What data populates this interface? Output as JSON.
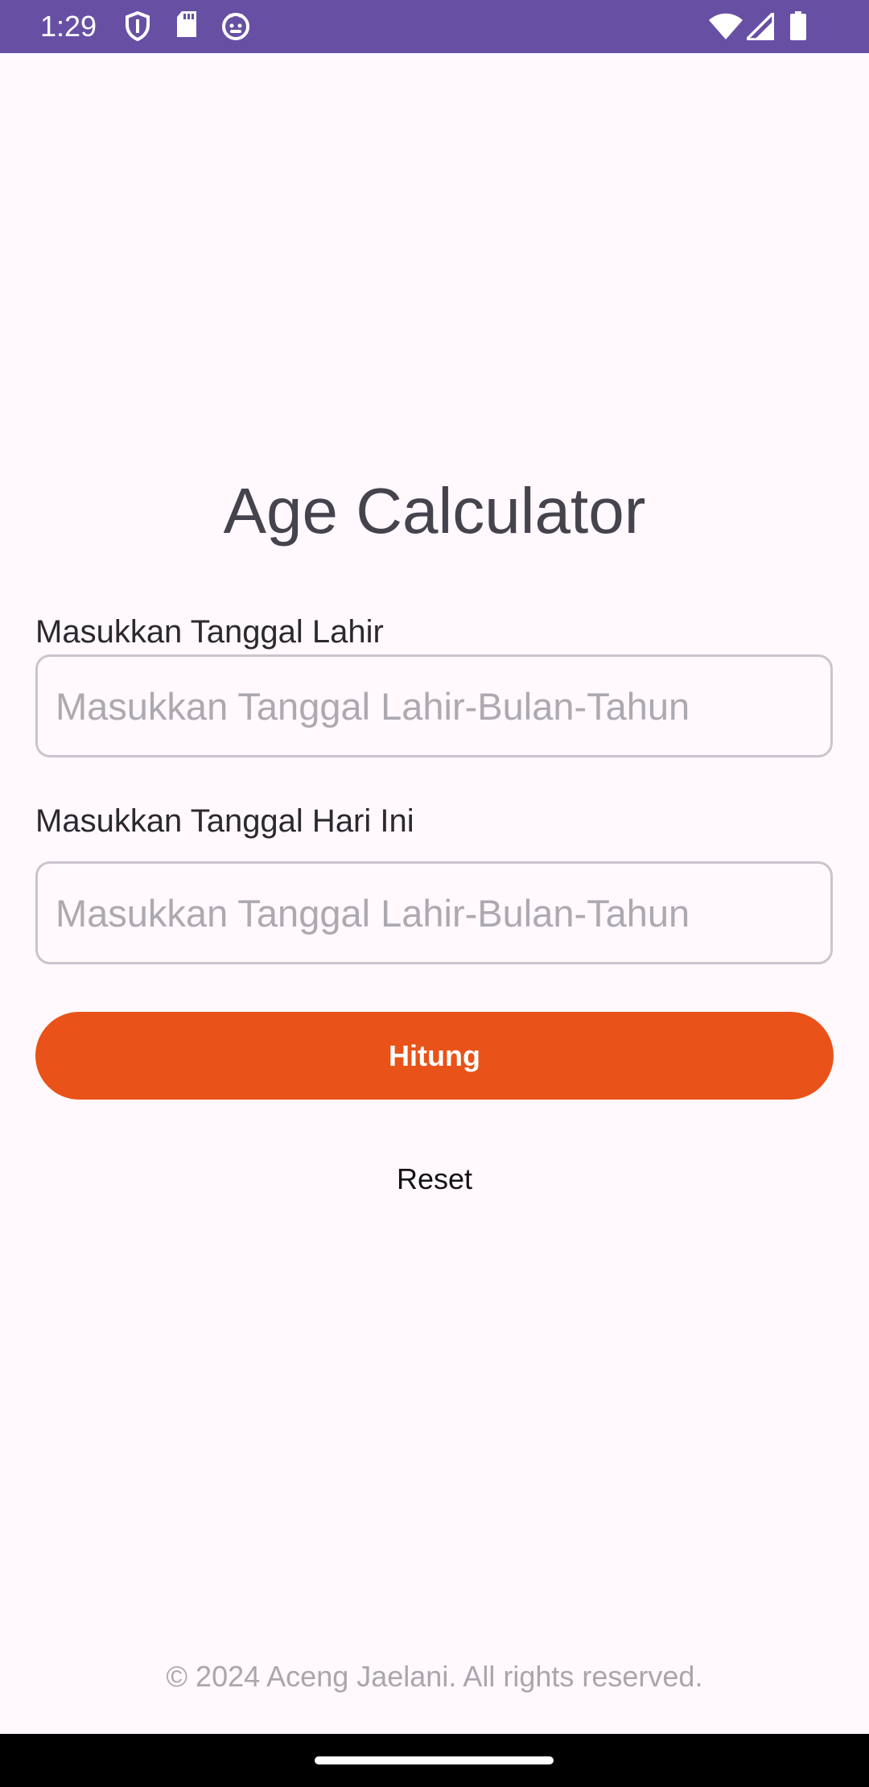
{
  "status_bar": {
    "time": "1:29",
    "icons": [
      "shield-icon",
      "sd-card-icon",
      "cat-face-icon",
      "wifi-icon",
      "cellular-signal-icon",
      "battery-icon"
    ],
    "color": "#6750A4"
  },
  "app": {
    "title": "Age Calculator"
  },
  "form": {
    "birth_date": {
      "label": "Masukkan Tanggal Lahir",
      "placeholder": "Masukkan Tanggal Lahir-Bulan-Tahun",
      "value": ""
    },
    "today_date": {
      "label": "Masukkan Tanggal Hari Ini",
      "placeholder": "Masukkan Tanggal Lahir-Bulan-Tahun",
      "value": ""
    },
    "calculate_label": "Hitung",
    "reset_label": "Reset"
  },
  "footer": {
    "text": "© 2024 Aceng Jaelani. All rights reserved."
  },
  "colors": {
    "accent": "#E95218",
    "background": "#FFF8FC",
    "status_bar": "#6750A4"
  }
}
